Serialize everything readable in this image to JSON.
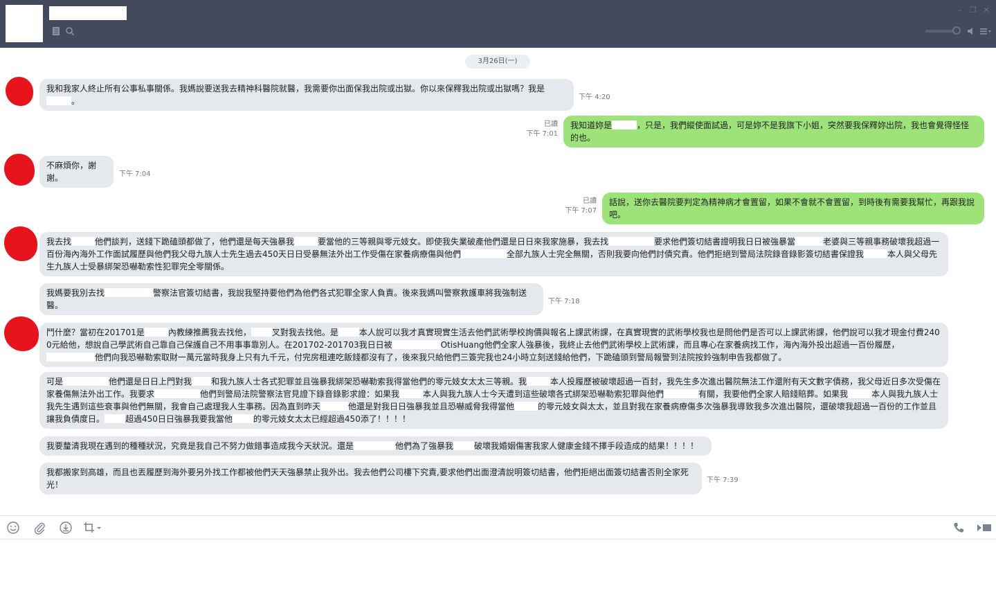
{
  "header": {
    "icons": [
      "notes-icon",
      "search-icon",
      "minimize-icon",
      "restore-icon",
      "close-icon",
      "volume-icon",
      "menu-icon"
    ]
  },
  "chat": {
    "date": "3月26日(一)",
    "msg1": {
      "text_a": "我和我家人終止所有公事私事關係。我媽說要送我去精神科醫院就醫，我需要你出面保我出院或出獄。你以來保釋我出院或出獄嗎？我是",
      "text_b": "。",
      "time": "下午 4:20"
    },
    "msg2": {
      "read": "已讀",
      "time": "下午 7:01",
      "text_a": "我知道妳是",
      "text_b": "，只是，我們縱使面試過，可是妳不是我旗下小姐，突然要我保釋妳出院，我也會覺得怪怪的也。"
    },
    "msg3": {
      "text": "不麻煩你，謝謝。",
      "time": "下午 7:04"
    },
    "msg4": {
      "read": "已讀",
      "time": "下午 7:07",
      "text": "話說，送你去醫院要判定為精神病才會置留，如果不會就不會置留，到時後有需要我幫忙，再跟我說吧。"
    },
    "msg5": {
      "t1": "我去找",
      "t2": "他們談判，送錢下跪磕頭都做了，他們還是每天強暴我",
      "t3": "要當他的三等親與零元妓女。即使我失業破產他們還是日日來我家施暴，我去找",
      "t4": "要求他們簽切結書證明我日日被強暴當",
      "t5": "老婆與三等親事務破壞我超過一百份海內海外工作面試履歷與他們我父母九族人士先生過去450天日日受暴無法外出工作受傷在家養病療傷與他們",
      "t6": "全部九族人士完全無關，否則我要向他們討債究責。他們拒絕到警局法院錄音錄影簽切結書保證我",
      "t7": "本人與父母先生九族人士受暴綁架恐嚇勒索性犯罪完全零關係。"
    },
    "msg6": {
      "t1": "我媽要我別去找",
      "t2": "警察法官簽切結書，我說我堅持要他們為他們各式犯罪全家人負責。後來我媽叫警察救護車將我強制送醫。",
      "time": "下午 7:18"
    },
    "msg7": {
      "t1": "鬥什麼？當初在201701是",
      "t2": "內教練推薦我去找他，",
      "t3": "叉對我去找他。是",
      "t4": "本人說可以我才真實現實生活去他們武術學校詢價與報名上課武術課，在真實現實的武術學校我也是問他們是否可以上課武術課，他們說可以我才現金付費2400元給他，想說自己學武術自己靠自己保護自己不用事事靠別人。在201702-201703我日日被",
      "t5": "OtisHuang他們全家人強暴後，我終止去他們武術學校上武術課，而且專心在家養病找工作，海內海外投出超過一百份履歷，",
      "t6": "他們向我恐嚇勒索取財一萬元當時我身上只有九千元，付完房租連吃飯錢都沒有了，後來我只給他們三簽完我也24小時立刻送錢給他們，下跪磕頭到警局報警到法院按鈴強制申告我都做了。"
    },
    "msg8": {
      "t1": "可是",
      "t2": "他們還是日日上門對我",
      "t3": "和我九族人士各式犯罪並且強暴我綁架恐嚇勒索我得當他們的零元妓女太太三等親。我",
      "t4": "本人投履歷被破壞超過一百封，我先生多次進出醫院無法工作還附有天文數字債務，我父母近日多次受傷在家養傷無法外出工作。我要求",
      "t5": "他們到警局法院警察法官見證下錄音錄影求證：如果我",
      "t6": "本人與我九族人士今天遭到這些破壞各式綁架恐嚇勒索犯罪與他們",
      "t7": "有關，我要他們全家人賠錢賠葬。如果我",
      "t8": "本人與我九族人士我先生遇到這些衰事與他們無關，我會自己處理我人生事務。因為直到昨天",
      "t9": "他還是對我日日強暴我並且恐嚇威脅我得當他",
      "t10": "的零元妓女與太太，並且對我在家養病療傷多次強暴我導致我多次進出醫院，還破壞我超過一百份的工作並且讓我負債度日。",
      "t11": "超過450日日強暴我要我當他",
      "t12": "的零元妓女太太已經超過450添了！！！！"
    },
    "msg9": {
      "t1": "我要釐清我現在遇到的種種狀況，究竟是我自己不努力做錯事造成我今天狀況。還是",
      "t2": "他們為了強暴我",
      "t3": "破壞我婚姻傷害我家人健康金錢不擇手段造成的結果！！！！"
    },
    "msg10": {
      "text": "我都搬家到高雄，而且也丟履歷到海外要另外找工作都被他們天天強暴禁止我外出。我去他們公司樓下究責,要求他們出面澄清說明簽切結書，他們拒絕出面簽切結書否則全家死光！",
      "time": "下午 7:39"
    }
  },
  "toolbar": {
    "icons": [
      "emoji-icon",
      "attach-icon",
      "download-icon",
      "crop-icon",
      "phone-icon",
      "video-icon"
    ]
  },
  "colors": {
    "header": "#434a5c",
    "incoming_bubble": "#e5e8ec",
    "outgoing_bubble": "#9ee27a",
    "avatar_blob": "#e8141c"
  }
}
